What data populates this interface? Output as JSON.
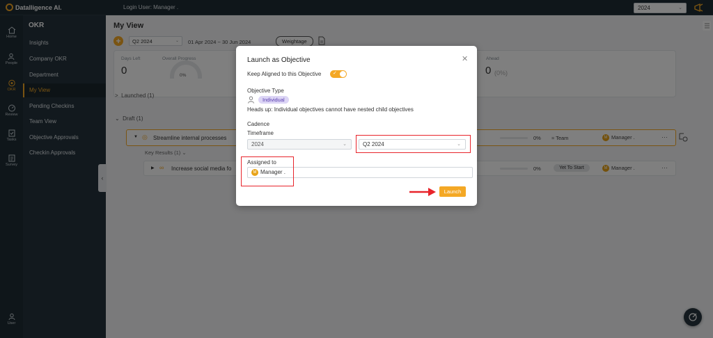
{
  "app": {
    "brand": "Datalligence AI.",
    "login_user": "Login User: Manager .",
    "year": "2024"
  },
  "rail": [
    {
      "label": "Home",
      "icon": "home-icon"
    },
    {
      "label": "People",
      "icon": "people-icon"
    },
    {
      "label": "OKR",
      "icon": "okr-icon",
      "active": true
    },
    {
      "label": "Review",
      "icon": "review-icon"
    },
    {
      "label": "Tasks",
      "icon": "tasks-icon"
    },
    {
      "label": "Survey",
      "icon": "survey-icon"
    },
    {
      "label": "User",
      "icon": "user-icon"
    }
  ],
  "sidebar": {
    "title": "OKR",
    "items": [
      "Insights",
      "Company OKR",
      "Department",
      "My View",
      "Pending Checkins",
      "Team View",
      "Objective Approvals",
      "Checkin Approvals"
    ],
    "active_index": 3
  },
  "main": {
    "title": "My View",
    "quarter": "Q2 2024",
    "date_range": "01 Apr 2024 ~ 30 Jun 2024",
    "weightage": "Weightage",
    "stats": {
      "days_left_label": "Days Left",
      "days_left": "0",
      "progress_label": "Overall Progress",
      "progress": "0%",
      "ahead_label": "Ahead",
      "ahead_value": "0",
      "ahead_pct": "(0%)"
    },
    "launched": "Launched (1)",
    "draft": "Draft (1)",
    "objective": {
      "title": "Streamline internal processes",
      "pct": "0%",
      "team": "Team",
      "owner": "Manager ."
    },
    "kr_header": "Key Results (1)",
    "kr": {
      "title": "Increase social media fo",
      "pct": "0%",
      "status": "Yet To Start",
      "owner": "Manager ."
    }
  },
  "modal": {
    "title": "Launch as Objective",
    "keep_aligned": "Keep Aligned to this Objective",
    "objective_type_label": "Objective Type",
    "objective_type": "Individual",
    "heads_up": "Heads up: Individual objectives cannot have nested child objectives",
    "cadence_label": "Cadence",
    "timeframe_label": "Timeframe",
    "year": "2024",
    "quarter": "Q2 2024",
    "assigned_label": "Assigned to",
    "assignee": "Manager .",
    "launch": "Launch"
  },
  "colors": {
    "accent": "#f4a825",
    "sidebar_bg": "#24333c",
    "highlight": "#e8232a",
    "chip_bg": "#dcd5f5"
  }
}
